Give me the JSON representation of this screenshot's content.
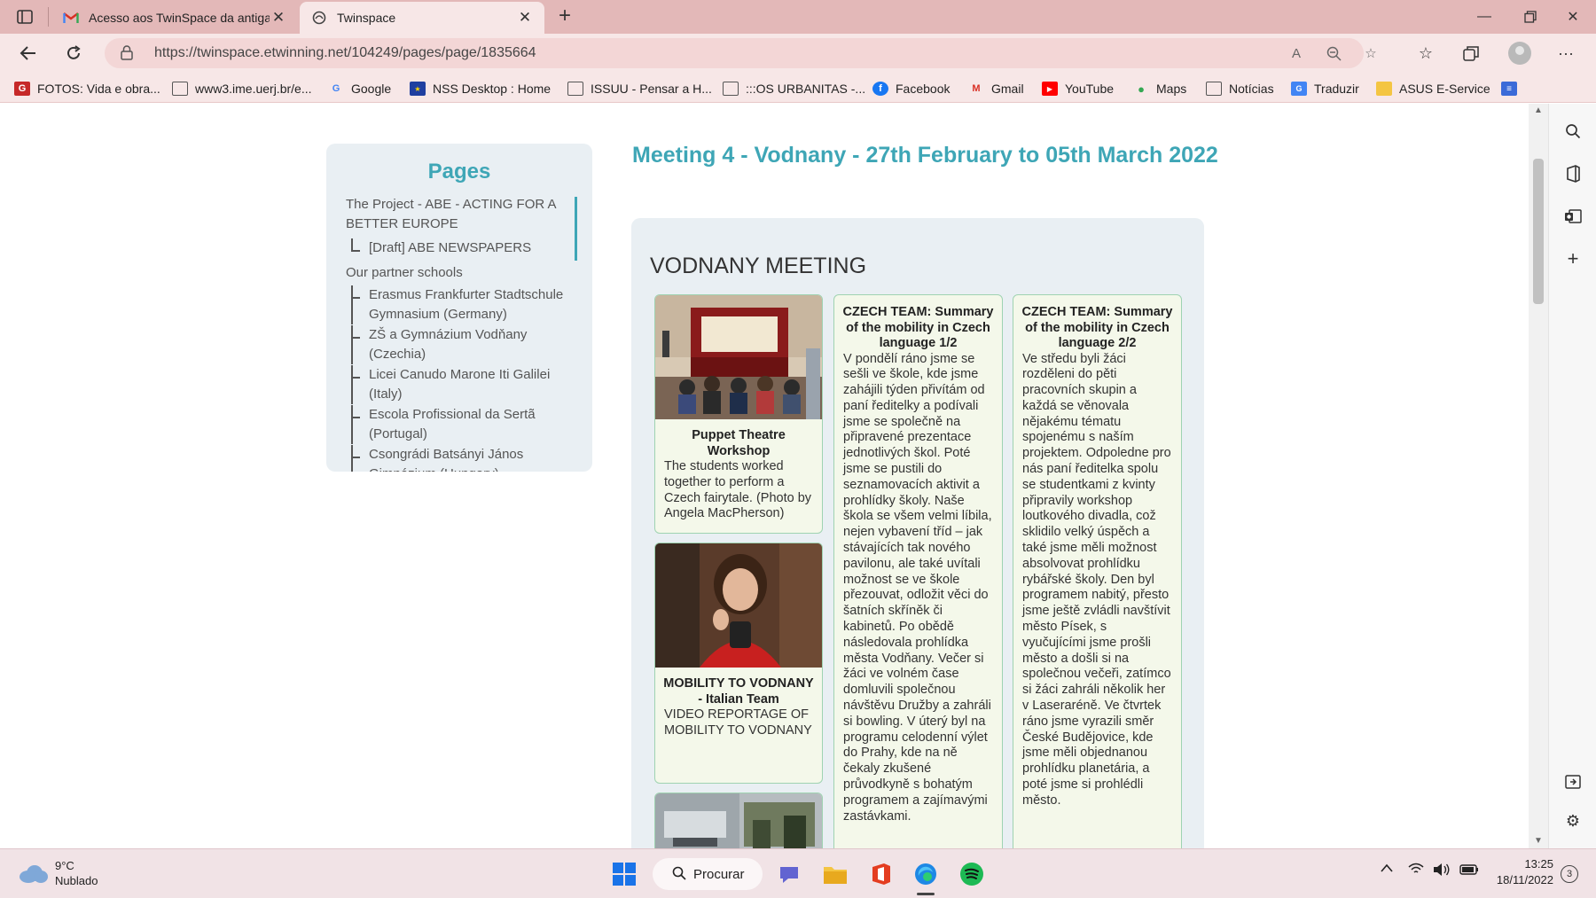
{
  "browser": {
    "tabs": [
      {
        "title": "Acesso aos TwinSpace da antiga",
        "icon": "gmail-icon"
      },
      {
        "title": "Twinspace",
        "icon": "etwinning-icon"
      }
    ],
    "url": "https://twinspace.etwinning.net/104249/pages/page/1835664",
    "bookmarks": [
      {
        "label": "FOTOS: Vida e obra...",
        "icon": "G"
      },
      {
        "label": "www3.ime.uerj.br/e...",
        "icon": "page"
      },
      {
        "label": "Google",
        "icon": "G"
      },
      {
        "label": "NSS Desktop : Home",
        "icon": "eu"
      },
      {
        "label": "ISSUU - Pensar a H...",
        "icon": "page"
      },
      {
        "label": ":::OS URBANITAS -...",
        "icon": "page"
      },
      {
        "label": "Facebook",
        "icon": "f"
      },
      {
        "label": "Gmail",
        "icon": "M"
      },
      {
        "label": "YouTube",
        "icon": "yt"
      },
      {
        "label": "Maps",
        "icon": "pin"
      },
      {
        "label": "Notícias",
        "icon": "page"
      },
      {
        "label": "Traduzir",
        "icon": "tr"
      },
      {
        "label": "ASUS E-Service",
        "icon": "folder"
      }
    ]
  },
  "sidebar": {
    "heading": "Pages",
    "items": [
      {
        "label": "The Project - ABE - ACTING FOR A BETTER EUROPE",
        "level": 0
      },
      {
        "label": "[Draft] ABE NEWSPAPERS",
        "level": 1
      },
      {
        "label": "Our partner schools",
        "level": 0
      },
      {
        "label": "Erasmus Frankfurter Stadtschule Gymnasium (Germany)",
        "level": 1
      },
      {
        "label": "ZŠ a Gymnázium Vodňany (Czechia)",
        "level": 1
      },
      {
        "label": "Licei Canudo Marone Iti Galilei (Italy)",
        "level": 1
      },
      {
        "label": "Escola Profissional da Sertã (Portugal)",
        "level": 1
      },
      {
        "label": "Csongrádi Batsányi János Gimnázium (Hungary)",
        "level": 1
      }
    ]
  },
  "main": {
    "page_title": "Meeting 4 - Vodnany - 27th February to 05th March 2022",
    "section_heading": "VODNANY MEETING",
    "cards": [
      {
        "title": "Puppet Theatre Workshop",
        "text": "The students worked together to perform a Czech fairytale. (Photo by Angela MacPherson)"
      },
      {
        "title": "MOBILITY TO VODNANY - Italian Team",
        "text": "VIDEO REPORTAGE OF MOBILITY TO VODNANY"
      },
      {
        "title": "CZECH TEAM: Summary of the mobility in Czech language 1/2",
        "text": "V pondělí ráno jsme se sešli ve škole, kde jsme zahájili týden přivítám od paní ředitelky a podívali jsme se společně na připravené prezentace jednotlivých škol. Poté jsme se pustili do seznamovacích aktivit a prohlídky školy. Naše škola se všem velmi líbila, nejen vybavení tříd – jak stávajících tak nového pavilonu, ale také uvítali možnost se ve škole přezouvat, odložit věci do šatních skříněk či kabinetů. Po obědě následovala prohlídka města Vodňany. Večer si žáci ve volném čase domluvili společnou návštěvu Družby a zahráli si bowling. V úterý byl na programu celodenní výlet do Prahy, kde na ně čekaly zkušené průvodkyně s bohatým programem a zajímavými zastávkami."
      },
      {
        "title": "CZECH TEAM: Summary of the mobility in Czech language 2/2",
        "text": "Ve středu byli žáci rozděleni do pěti pracovních skupin a každá se věnovala nějakému tématu spojenému s naším projektem. Odpoledne pro nás paní ředitelka spolu se studentkami z kvinty připravily workshop loutkového divadla, což sklidilo velký úspěch a také jsme měli možnost absolvovat prohlídku rybářské školy. Den byl programem nabitý, přesto jsme ještě zvládli navštívit město Písek, s vyučujícími jsme prošli město a došli si na společnou večeři, zatímco si žáci zahráli několik her v Laseraréně. Ve čtvrtek ráno jsme vyrazili směr České Budějovice, kde jsme měli objednanou prohlídku planetária, a poté jsme si prohlédli město."
      }
    ]
  },
  "taskbar": {
    "weather_temp": "9°C",
    "weather_desc": "Nublado",
    "search_label": "Procurar",
    "time": "13:25",
    "date": "18/11/2022",
    "notifications": "3"
  },
  "colors": {
    "accent": "#3ea6b6",
    "titlebar": "#e3b8b8",
    "card_border": "#9fd3b1",
    "panel_bg": "#e9eff3"
  }
}
